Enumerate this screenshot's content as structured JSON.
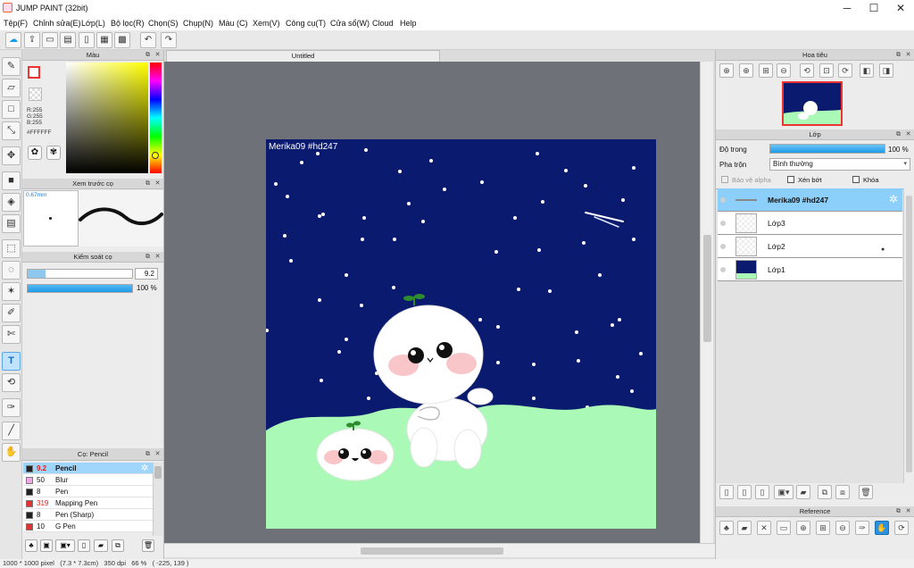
{
  "window": {
    "title": "JUMP PAINT (32bit)",
    "minimize": "─",
    "maximize": "☐",
    "close": "✕"
  },
  "menu": [
    "Tệp(F)",
    "Chỉnh sửa(E)",
    "Lớp(L)",
    "Bộ lọc(R)",
    "Chọn(S)",
    "Chụp(N)",
    "Màu (C)",
    "Xem(V)",
    "Công cụ(T)",
    "Cửa sổ(W)",
    "Cloud",
    "Help"
  ],
  "toolbar_icons": [
    "cloud-icon",
    "share-icon",
    "comment-icon",
    "chat-icon",
    "page-icon",
    "grid-icon",
    "grid-alt-icon",
    "undo-icon",
    "redo-icon"
  ],
  "tools": [
    "brush-icon",
    "eraser-icon",
    "rectangle-icon",
    "line-icon",
    "move-icon",
    "fill-rect-icon",
    "bucket-icon",
    "gradient-icon",
    "rect-select-icon",
    "lasso-icon",
    "magic-wand-icon",
    "select-pen-icon",
    "select-erase-icon",
    "text-icon",
    "transform-icon",
    "eyedropper-icon",
    "line-pen-icon",
    "hand-icon"
  ],
  "tool_glyphs": [
    "✎",
    "▱",
    "□",
    "⤡",
    "✥",
    "■",
    "◈",
    "▤",
    "⬚",
    "◌",
    "✶",
    "✐",
    "✄",
    "T",
    "⟲",
    "✑",
    "╱",
    "✋"
  ],
  "color_panel": {
    "title": "Màu",
    "r": "R:255",
    "g": "G:255",
    "b": "B:255",
    "hex": "#FFFFFF"
  },
  "preview_panel": {
    "title": "Xem trước cọ",
    "size": "0.67mm"
  },
  "control_panel": {
    "title": "Kiểm soát cọ",
    "size_value": "9.2",
    "size_fraction": 0.17,
    "opacity_value": "100 %",
    "opacity_fraction": 1.0
  },
  "brush_panel": {
    "title": "Cọ: Pencil",
    "brushes": [
      {
        "size": "9.2",
        "name": "Pencil",
        "color": "#222222",
        "selected": true,
        "red": true
      },
      {
        "size": "50",
        "name": "Blur",
        "color": "#f5a6e8",
        "selected": false,
        "red": false
      },
      {
        "size": "8",
        "name": "Pen",
        "color": "#222222",
        "selected": false,
        "red": false
      },
      {
        "size": "319",
        "name": "Mapping Pen",
        "color": "#e03232",
        "selected": false,
        "red": true
      },
      {
        "size": "8",
        "name": "Pen (Sharp)",
        "color": "#222222",
        "selected": false,
        "red": false
      },
      {
        "size": "10",
        "name": "G Pen",
        "color": "#e03232",
        "selected": false,
        "red": false
      }
    ]
  },
  "document": {
    "tab": "Untitled",
    "canvas_text": "Merika09  #hd247"
  },
  "navigator": {
    "title": "Hoa tiêu"
  },
  "layers_panel": {
    "title": "Lớp",
    "opacity_label": "Độ trong",
    "opacity_value": "100 %",
    "opacity_fraction": 1.0,
    "blend_label": "Pha trộn",
    "blend_value": "Bình thường",
    "protect_alpha": "Bảo vệ alpha",
    "clip": "Xén bớt",
    "lock": "Khóa",
    "layers": [
      {
        "name": "Merika09  #hd247",
        "selected": true
      },
      {
        "name": "Lớp3",
        "selected": false
      },
      {
        "name": "Lớp2",
        "selected": false
      },
      {
        "name": "Lớp1",
        "selected": false
      }
    ]
  },
  "reference_panel": {
    "title": "Reference"
  },
  "status": {
    "text": "1000 * 1000 pixel   (7.3 * 7.3cm)   350 dpi   66 %   ( -225, 139 )"
  },
  "colors": {
    "sky": "#0a1a6e",
    "grass": "#aaf9b6",
    "accent": "#1e9be8",
    "selection": "#8ccffb"
  }
}
